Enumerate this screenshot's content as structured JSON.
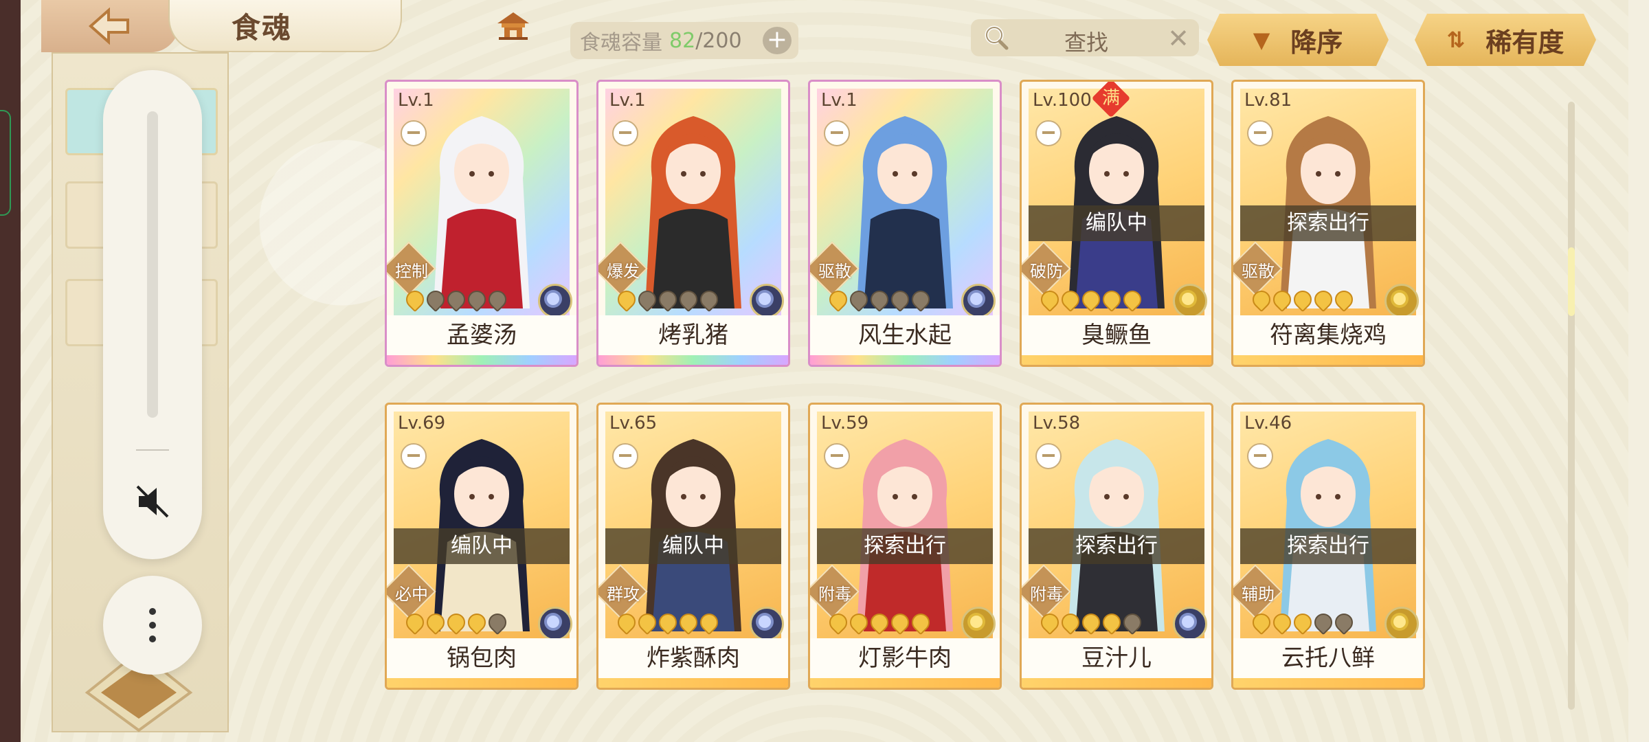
{
  "header": {
    "title": "食魂",
    "capacity_label": "食魂容量",
    "capacity_current": "82",
    "capacity_sep": "/",
    "capacity_max": "200",
    "plus": "+",
    "search_label": "查找",
    "search_clear": "✕",
    "sort_order_label": "降序",
    "sort_by_label": "稀有度"
  },
  "icons": {
    "back": "back-arrow-icon",
    "home": "pavilion-home-icon",
    "search": "magnifier-icon",
    "sort": "sort-icon",
    "mute": "speaker-muted-icon",
    "more": "more-vertical-icon"
  },
  "colors": {
    "accent_gold": "#e5b55a",
    "capacity_ok": "#7fcb6a",
    "max_badge": "#e63b2e"
  },
  "cards": [
    {
      "level": "Lv.1",
      "name": "孟婆汤",
      "tag": "控制",
      "status": "",
      "max": "",
      "rainbow": true,
      "stars_on": 1,
      "element": "blue"
    },
    {
      "level": "Lv.1",
      "name": "烤乳猪",
      "tag": "爆发",
      "status": "",
      "max": "",
      "rainbow": true,
      "stars_on": 1,
      "element": "blue"
    },
    {
      "level": "Lv.1",
      "name": "风生水起",
      "tag": "驱散",
      "status": "",
      "max": "",
      "rainbow": true,
      "stars_on": 1,
      "element": "blue"
    },
    {
      "level": "Lv.100",
      "name": "臭鳜鱼",
      "tag": "破防",
      "status": "编队中",
      "max": "满",
      "rainbow": false,
      "stars_on": 5,
      "element": "gold"
    },
    {
      "level": "Lv.81",
      "name": "符离集烧鸡",
      "tag": "驱散",
      "status": "探索出行",
      "max": "",
      "rainbow": false,
      "stars_on": 5,
      "element": "gold"
    },
    {
      "level": "Lv.69",
      "name": "锅包肉",
      "tag": "必中",
      "status": "编队中",
      "max": "",
      "rainbow": false,
      "stars_on": 4,
      "element": "blue"
    },
    {
      "level": "Lv.65",
      "name": "炸紫酥肉",
      "tag": "群攻",
      "status": "编队中",
      "max": "",
      "rainbow": false,
      "stars_on": 5,
      "element": "blue"
    },
    {
      "level": "Lv.59",
      "name": "灯影牛肉",
      "tag": "附毒",
      "status": "探索出行",
      "max": "",
      "rainbow": false,
      "stars_on": 5,
      "element": "gold"
    },
    {
      "level": "Lv.58",
      "name": "豆汁儿",
      "tag": "附毒",
      "status": "探索出行",
      "max": "",
      "rainbow": false,
      "stars_on": 4,
      "element": "blue"
    },
    {
      "level": "Lv.46",
      "name": "云托八鲜",
      "tag": "辅助",
      "status": "探索出行",
      "max": "",
      "rainbow": false,
      "stars_on": 3,
      "element": "gold"
    }
  ]
}
